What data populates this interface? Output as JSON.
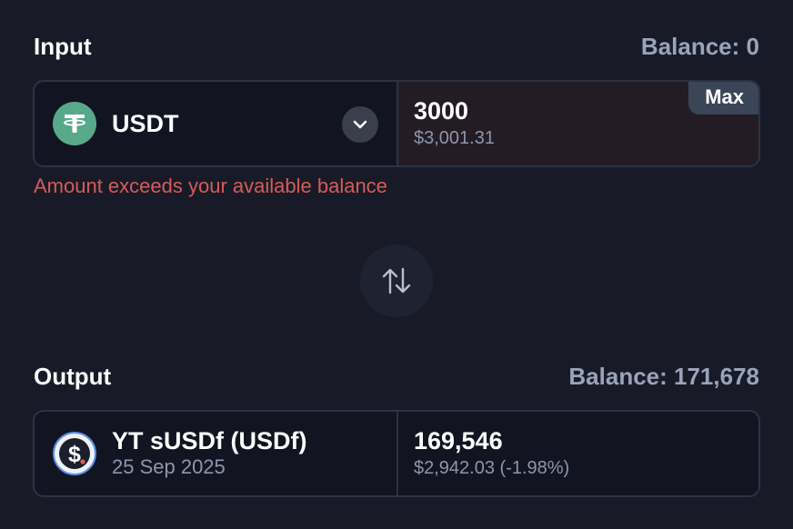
{
  "input": {
    "title": "Input",
    "balance_label": "Balance: 0",
    "token": {
      "symbol": "USDT",
      "icon": "tether-icon",
      "icon_color": "#58a98b"
    },
    "amount": "3000",
    "amount_usd": "$3,001.31",
    "max_label": "Max",
    "error": "Amount exceeds your available balance",
    "error_color": "#d65b5b"
  },
  "switch": {
    "icon": "swap-arrows-icon"
  },
  "output": {
    "title": "Output",
    "balance_label": "Balance: 171,678",
    "token": {
      "name": "YT sUSDf (USDf)",
      "maturity": "25 Sep 2025",
      "icon": "dollar-coin-icon"
    },
    "amount": "169,546",
    "amount_usd": "$2,942.03 (-1.98%)"
  }
}
